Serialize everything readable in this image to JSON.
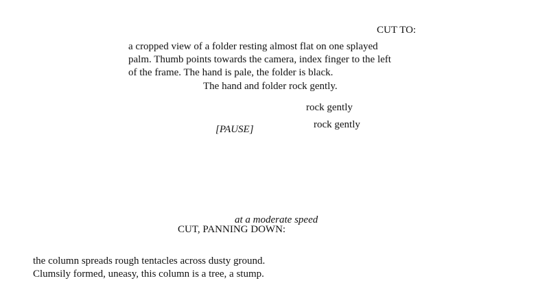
{
  "script": {
    "cut_to": "CUT TO:",
    "description_lines": [
      "a cropped view of a folder resting almost flat on one splayed",
      "palm. Thumb points towards the camera, index finger to the left",
      "of the frame. The hand is pale, the folder is black."
    ],
    "action_line": "The hand and folder rock gently.",
    "rock_gently_1": "rock gently",
    "rock_gently_2": "rock gently",
    "pause": "[PAUSE]",
    "speed_note": "at a moderate speed",
    "cut_panning": "CUT, PANNING DOWN:",
    "final_lines": [
      "the column spreads rough tentacles across dusty ground.",
      "Clumsily formed, uneasy, this column is a tree, a stump."
    ]
  }
}
